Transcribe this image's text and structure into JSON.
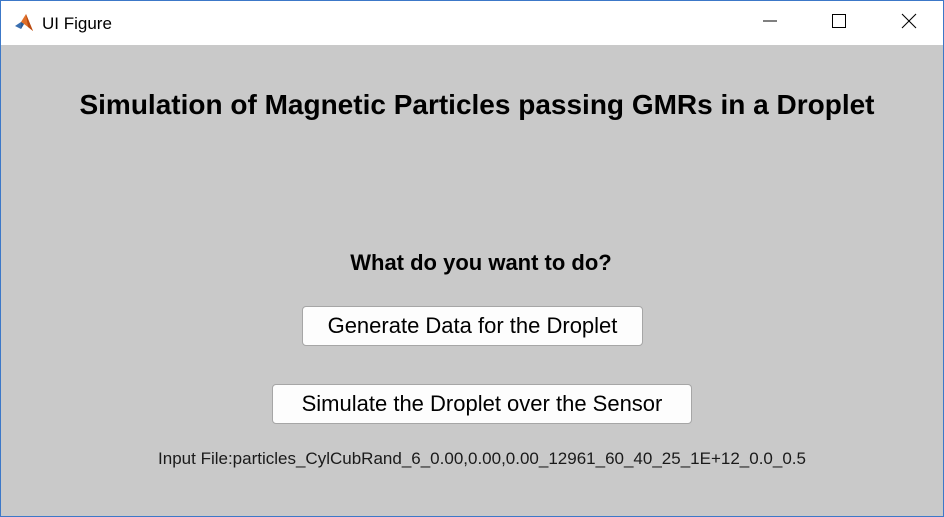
{
  "window": {
    "title": "UI Figure",
    "icon": "matlab-icon"
  },
  "window_controls": {
    "minimize_icon": "minimize-icon",
    "maximize_icon": "maximize-icon",
    "close_icon": "close-icon"
  },
  "main": {
    "heading": "Simulation of Magnetic Particles passing GMRs in a Droplet",
    "question": "What do you want to do?",
    "generate_button_label": "Generate Data for the Droplet",
    "simulate_button_label": "Simulate the Droplet over the Sensor",
    "input_file_text": "Input File:particles_CylCubRand_6_0.00,0.00,0.00_12961_60_40_25_1E+12_0.0_0.5"
  },
  "colors": {
    "background": "#c9c9c9",
    "titlebar": "#ffffff",
    "button_face": "#fdfdfd",
    "button_border": "#a6a6a6",
    "window_border": "#3c78c8"
  }
}
